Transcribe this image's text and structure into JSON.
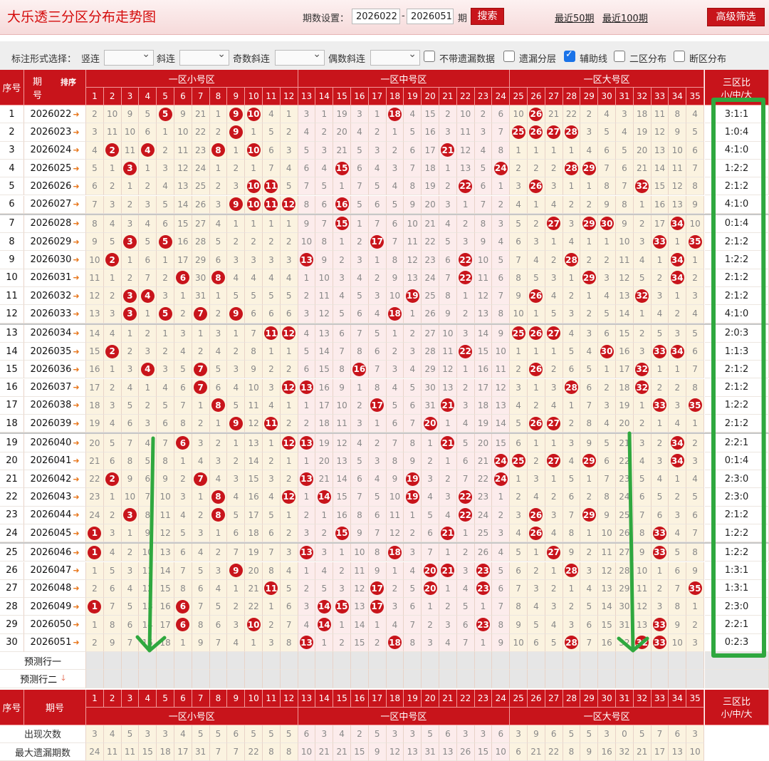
{
  "header": {
    "title": "大乐透三分区分布走势图",
    "period_label": "期数设置：",
    "from": "2026022",
    "dash": "-",
    "to": "2026051",
    "unit": "期",
    "search_btn": "搜索",
    "recent50": "最近50期",
    "recent100": "最近100期",
    "advanced": "高级筛选"
  },
  "options": {
    "label": "标注形式选择：",
    "vertical": "竖连",
    "slant": "斜连",
    "odd_slant": "奇数斜连",
    "even_slant": "偶数斜连",
    "chk_nomiss": "不带遗漏数据",
    "chk_layer": "遗漏分层",
    "chk_aux": "辅助线",
    "chk_two": "二区分布",
    "chk_break": "断区分布"
  },
  "table": {
    "col_seq": "序号",
    "col_issue1": "期",
    "col_issue2": "号",
    "sort": "排序",
    "zone1": "一区小号区",
    "zone2": "一区中号区",
    "zone3": "一区大号区",
    "ratio_head": "三区比",
    "ratio_sub": "小/中/大",
    "numbers": [
      "1",
      "2",
      "3",
      "4",
      "5",
      "6",
      "7",
      "8",
      "9",
      "10",
      "11",
      "12",
      "13",
      "14",
      "15",
      "16",
      "17",
      "18",
      "19",
      "20",
      "21",
      "22",
      "23",
      "24",
      "25",
      "26",
      "27",
      "28",
      "29",
      "30",
      "31",
      "32",
      "33",
      "34",
      "35"
    ],
    "rows": [
      {
        "seq": "1",
        "issue": "2026022",
        "ratio": "3:1:1",
        "vals": [
          2,
          10,
          9,
          5,
          "5",
          9,
          21,
          1,
          "9",
          "10",
          4,
          1,
          3,
          1,
          19,
          3,
          1,
          "18",
          4,
          15,
          2,
          10,
          2,
          6,
          10,
          "26",
          21,
          22,
          2,
          4,
          3,
          18,
          11,
          8,
          4
        ]
      },
      {
        "seq": "2",
        "issue": "2026023",
        "ratio": "1:0:4",
        "vals": [
          3,
          11,
          10,
          6,
          1,
          10,
          22,
          2,
          "9",
          1,
          5,
          2,
          4,
          2,
          20,
          4,
          2,
          1,
          5,
          16,
          3,
          11,
          3,
          7,
          "25",
          "26",
          "27",
          "28",
          3,
          5,
          4,
          19,
          12,
          9,
          5
        ]
      },
      {
        "seq": "3",
        "issue": "2026024",
        "ratio": "4:1:0",
        "vals": [
          4,
          "2",
          11,
          "4",
          2,
          11,
          23,
          "8",
          1,
          "10",
          6,
          3,
          5,
          3,
          21,
          5,
          3,
          2,
          6,
          17,
          "21",
          12,
          4,
          8,
          1,
          1,
          1,
          1,
          4,
          6,
          5,
          20,
          13,
          10,
          6
        ]
      },
      {
        "seq": "4",
        "issue": "2026025",
        "ratio": "1:2:2",
        "vals": [
          5,
          1,
          "3",
          1,
          3,
          12,
          24,
          1,
          2,
          1,
          7,
          4,
          6,
          4,
          "15",
          6,
          4,
          3,
          7,
          18,
          1,
          13,
          5,
          "24",
          2,
          2,
          2,
          "28",
          "29",
          7,
          6,
          21,
          14,
          11,
          7
        ]
      },
      {
        "seq": "5",
        "issue": "2026026",
        "ratio": "2:1:2",
        "vals": [
          6,
          2,
          1,
          2,
          4,
          13,
          25,
          2,
          3,
          "10",
          "11",
          5,
          7,
          5,
          1,
          7,
          5,
          4,
          8,
          19,
          2,
          "22",
          6,
          1,
          3,
          "26",
          3,
          1,
          1,
          8,
          7,
          "32",
          15,
          12,
          8
        ]
      },
      {
        "seq": "6",
        "issue": "2026027",
        "ratio": "4:1:0",
        "vals": [
          7,
          3,
          2,
          3,
          5,
          14,
          26,
          3,
          "9",
          "10",
          "11",
          "12",
          8,
          6,
          "16",
          5,
          6,
          5,
          9,
          20,
          3,
          1,
          7,
          2,
          4,
          1,
          4,
          2,
          2,
          9,
          8,
          1,
          16,
          13,
          9
        ]
      },
      {
        "seq": "7",
        "issue": "2026028",
        "ratio": "0:1:4",
        "vals": [
          8,
          4,
          3,
          4,
          6,
          15,
          27,
          4,
          1,
          1,
          1,
          1,
          9,
          7,
          "15",
          1,
          7,
          6,
          10,
          21,
          4,
          2,
          8,
          3,
          5,
          2,
          "27",
          3,
          "29",
          "30",
          9,
          2,
          17,
          "34",
          10
        ]
      },
      {
        "seq": "8",
        "issue": "2026029",
        "ratio": "2:1:2",
        "vals": [
          9,
          5,
          "3",
          5,
          "5",
          16,
          28,
          5,
          2,
          2,
          2,
          2,
          10,
          8,
          1,
          2,
          "17",
          7,
          11,
          22,
          5,
          3,
          9,
          4,
          6,
          3,
          1,
          4,
          1,
          1,
          10,
          3,
          "33",
          1,
          "35"
        ]
      },
      {
        "seq": "9",
        "issue": "2026030",
        "ratio": "1:2:2",
        "vals": [
          10,
          "2",
          1,
          6,
          1,
          17,
          29,
          6,
          3,
          3,
          3,
          3,
          "13",
          9,
          2,
          3,
          1,
          8,
          12,
          23,
          6,
          "22",
          10,
          5,
          7,
          4,
          2,
          "28",
          2,
          2,
          11,
          4,
          1,
          "34",
          1
        ]
      },
      {
        "seq": "10",
        "issue": "2026031",
        "ratio": "2:1:2",
        "vals": [
          11,
          1,
          2,
          7,
          2,
          "6",
          30,
          "8",
          4,
          4,
          4,
          4,
          1,
          10,
          3,
          4,
          2,
          9,
          13,
          24,
          7,
          "22",
          11,
          6,
          8,
          5,
          3,
          1,
          "29",
          3,
          12,
          5,
          2,
          "34",
          2
        ]
      },
      {
        "seq": "11",
        "issue": "2026032",
        "ratio": "2:1:2",
        "vals": [
          12,
          2,
          "3",
          "4",
          3,
          1,
          31,
          1,
          5,
          5,
          5,
          5,
          2,
          11,
          4,
          5,
          3,
          10,
          "19",
          25,
          8,
          1,
          12,
          7,
          9,
          "26",
          4,
          2,
          1,
          4,
          13,
          "32",
          3,
          1,
          3
        ]
      },
      {
        "seq": "12",
        "issue": "2026033",
        "ratio": "4:1:0",
        "vals": [
          13,
          3,
          "3",
          1,
          "5",
          2,
          "7",
          2,
          "9",
          6,
          6,
          6,
          3,
          12,
          5,
          6,
          4,
          "18",
          1,
          26,
          9,
          2,
          13,
          8,
          10,
          1,
          5,
          3,
          2,
          5,
          14,
          1,
          4,
          2,
          4
        ]
      },
      {
        "seq": "13",
        "issue": "2026034",
        "ratio": "2:0:3",
        "vals": [
          14,
          4,
          1,
          2,
          1,
          3,
          1,
          3,
          1,
          7,
          "11",
          "12",
          4,
          13,
          6,
          7,
          5,
          1,
          2,
          27,
          10,
          3,
          14,
          9,
          "25",
          "26",
          "27",
          4,
          3,
          6,
          15,
          2,
          5,
          3,
          5
        ]
      },
      {
        "seq": "14",
        "issue": "2026035",
        "ratio": "1:1:3",
        "vals": [
          15,
          "2",
          2,
          3,
          2,
          4,
          2,
          4,
          2,
          8,
          1,
          1,
          5,
          14,
          7,
          8,
          6,
          2,
          3,
          28,
          11,
          "22",
          15,
          10,
          1,
          1,
          1,
          5,
          4,
          "30",
          16,
          3,
          "33",
          "34",
          6
        ]
      },
      {
        "seq": "15",
        "issue": "2026036",
        "ratio": "2:1:2",
        "vals": [
          16,
          1,
          3,
          "4",
          3,
          5,
          "7",
          5,
          3,
          9,
          2,
          2,
          6,
          15,
          8,
          "16",
          7,
          3,
          4,
          29,
          12,
          1,
          16,
          11,
          2,
          "26",
          2,
          6,
          5,
          1,
          17,
          "32",
          1,
          1,
          7
        ]
      },
      {
        "seq": "16",
        "issue": "2026037",
        "ratio": "2:1:2",
        "vals": [
          17,
          2,
          4,
          1,
          4,
          6,
          "7",
          6,
          4,
          10,
          3,
          "12",
          "13",
          16,
          9,
          1,
          8,
          4,
          5,
          30,
          13,
          2,
          17,
          12,
          3,
          1,
          3,
          "28",
          6,
          2,
          18,
          "32",
          2,
          2,
          8
        ]
      },
      {
        "seq": "17",
        "issue": "2026038",
        "ratio": "1:2:2",
        "vals": [
          18,
          3,
          5,
          2,
          5,
          7,
          1,
          "8",
          5,
          11,
          4,
          1,
          1,
          17,
          10,
          2,
          "17",
          5,
          6,
          31,
          "21",
          3,
          18,
          13,
          4,
          2,
          4,
          1,
          7,
          3,
          19,
          1,
          "33",
          3,
          "35"
        ]
      },
      {
        "seq": "18",
        "issue": "2026039",
        "ratio": "2:1:2",
        "vals": [
          19,
          4,
          6,
          3,
          6,
          8,
          2,
          1,
          "9",
          12,
          "11",
          2,
          2,
          18,
          11,
          3,
          1,
          6,
          7,
          "20",
          1,
          4,
          19,
          14,
          5,
          "26",
          "27",
          2,
          8,
          4,
          20,
          2,
          1,
          4,
          1
        ]
      },
      {
        "seq": "19",
        "issue": "2026040",
        "ratio": "2:2:1",
        "vals": [
          20,
          5,
          7,
          4,
          7,
          "6",
          3,
          2,
          1,
          13,
          1,
          "12",
          "13",
          19,
          12,
          4,
          2,
          7,
          8,
          1,
          "21",
          5,
          20,
          15,
          6,
          1,
          1,
          3,
          9,
          5,
          21,
          3,
          2,
          "34",
          2
        ]
      },
      {
        "seq": "20",
        "issue": "2026041",
        "ratio": "0:1:4",
        "vals": [
          21,
          6,
          8,
          5,
          8,
          1,
          4,
          3,
          2,
          14,
          2,
          1,
          1,
          20,
          13,
          5,
          3,
          8,
          9,
          2,
          1,
          6,
          21,
          "24",
          "25",
          2,
          "27",
          4,
          "29",
          6,
          22,
          4,
          3,
          "34",
          3
        ]
      },
      {
        "seq": "21",
        "issue": "2026042",
        "ratio": "2:3:0",
        "vals": [
          22,
          "2",
          9,
          6,
          9,
          2,
          "7",
          4,
          3,
          15,
          3,
          2,
          "13",
          21,
          14,
          6,
          4,
          9,
          "19",
          3,
          2,
          7,
          22,
          "24",
          1,
          3,
          1,
          5,
          1,
          7,
          23,
          5,
          4,
          1,
          4
        ]
      },
      {
        "seq": "22",
        "issue": "2026043",
        "ratio": "2:3:0",
        "vals": [
          23,
          1,
          10,
          7,
          10,
          3,
          1,
          "8",
          4,
          16,
          4,
          "12",
          1,
          "14",
          15,
          7,
          5,
          10,
          "19",
          4,
          3,
          "22",
          23,
          1,
          2,
          4,
          2,
          6,
          2,
          8,
          24,
          6,
          5,
          2,
          5
        ]
      },
      {
        "seq": "23",
        "issue": "2026044",
        "ratio": "2:1:2",
        "vals": [
          24,
          2,
          "3",
          8,
          11,
          4,
          2,
          "8",
          5,
          17,
          5,
          1,
          2,
          1,
          16,
          8,
          6,
          11,
          1,
          5,
          4,
          "22",
          24,
          2,
          3,
          "26",
          3,
          7,
          "29",
          9,
          25,
          7,
          6,
          3,
          6
        ]
      },
      {
        "seq": "24",
        "issue": "2026045",
        "ratio": "1:2:2",
        "vals": [
          "1",
          3,
          1,
          9,
          12,
          5,
          3,
          1,
          6,
          18,
          6,
          2,
          3,
          2,
          "15",
          9,
          7,
          12,
          2,
          6,
          "21",
          1,
          25,
          3,
          4,
          "26",
          4,
          8,
          1,
          10,
          26,
          8,
          "33",
          4,
          7
        ]
      },
      {
        "seq": "25",
        "issue": "2026046",
        "ratio": "1:2:2",
        "vals": [
          "1",
          4,
          2,
          10,
          13,
          6,
          4,
          2,
          7,
          19,
          7,
          3,
          "13",
          3,
          1,
          10,
          8,
          "18",
          3,
          7,
          1,
          2,
          26,
          4,
          5,
          1,
          "27",
          9,
          2,
          11,
          27,
          9,
          "33",
          5,
          8
        ]
      },
      {
        "seq": "26",
        "issue": "2026047",
        "ratio": "1:3:1",
        "vals": [
          1,
          5,
          3,
          11,
          14,
          7,
          5,
          3,
          "9",
          20,
          8,
          4,
          1,
          4,
          2,
          11,
          9,
          1,
          4,
          "20",
          "21",
          3,
          "23",
          5,
          6,
          2,
          1,
          "28",
          3,
          12,
          28,
          10,
          1,
          6,
          9
        ]
      },
      {
        "seq": "27",
        "issue": "2026048",
        "ratio": "1:3:1",
        "vals": [
          2,
          6,
          4,
          12,
          15,
          8,
          6,
          4,
          1,
          21,
          "11",
          5,
          2,
          5,
          3,
          12,
          "17",
          2,
          5,
          "20",
          1,
          4,
          "23",
          6,
          7,
          3,
          2,
          1,
          4,
          13,
          29,
          11,
          2,
          7,
          "35"
        ]
      },
      {
        "seq": "28",
        "issue": "2026049",
        "ratio": "2:3:0",
        "vals": [
          "1",
          7,
          5,
          13,
          16,
          "6",
          7,
          5,
          2,
          22,
          1,
          6,
          3,
          "14",
          "15",
          13,
          "17",
          3,
          6,
          1,
          2,
          5,
          1,
          7,
          8,
          4,
          3,
          2,
          5,
          14,
          30,
          12,
          3,
          8,
          1
        ]
      },
      {
        "seq": "29",
        "issue": "2026050",
        "ratio": "2:2:1",
        "vals": [
          1,
          8,
          6,
          14,
          17,
          "6",
          8,
          6,
          3,
          "10",
          2,
          7,
          4,
          "14",
          1,
          14,
          1,
          4,
          7,
          2,
          3,
          6,
          "23",
          8,
          9,
          5,
          4,
          3,
          6,
          15,
          31,
          13,
          "33",
          9,
          2
        ]
      },
      {
        "seq": "30",
        "issue": "2026051",
        "ratio": "0:2:3",
        "vals": [
          2,
          9,
          7,
          15,
          18,
          1,
          9,
          7,
          4,
          1,
          3,
          8,
          "13",
          1,
          2,
          15,
          2,
          "18",
          8,
          3,
          4,
          7,
          1,
          9,
          10,
          6,
          5,
          "28",
          7,
          16,
          32,
          "32",
          "33",
          10,
          3
        ]
      }
    ],
    "pred1": "预测行一",
    "pred2": "预测行二",
    "stat_appear": "出现次数",
    "stat_maxmiss": "最大遗漏期数",
    "appear": [
      3,
      4,
      5,
      3,
      3,
      4,
      5,
      5,
      6,
      5,
      5,
      5,
      6,
      3,
      4,
      2,
      5,
      3,
      3,
      5,
      6,
      3,
      3,
      6,
      3,
      9,
      6,
      5,
      5,
      3,
      0,
      5,
      7,
      6,
      3
    ],
    "maxmiss": [
      24,
      11,
      11,
      15,
      18,
      17,
      31,
      7,
      7,
      22,
      8,
      8,
      10,
      21,
      21,
      15,
      9,
      12,
      13,
      31,
      13,
      26,
      15,
      10,
      6,
      21,
      22,
      8,
      9,
      16,
      32,
      21,
      17,
      13,
      10
    ]
  },
  "colors": {
    "red": "#c8141b",
    "annot_green": "#2fa83f"
  }
}
